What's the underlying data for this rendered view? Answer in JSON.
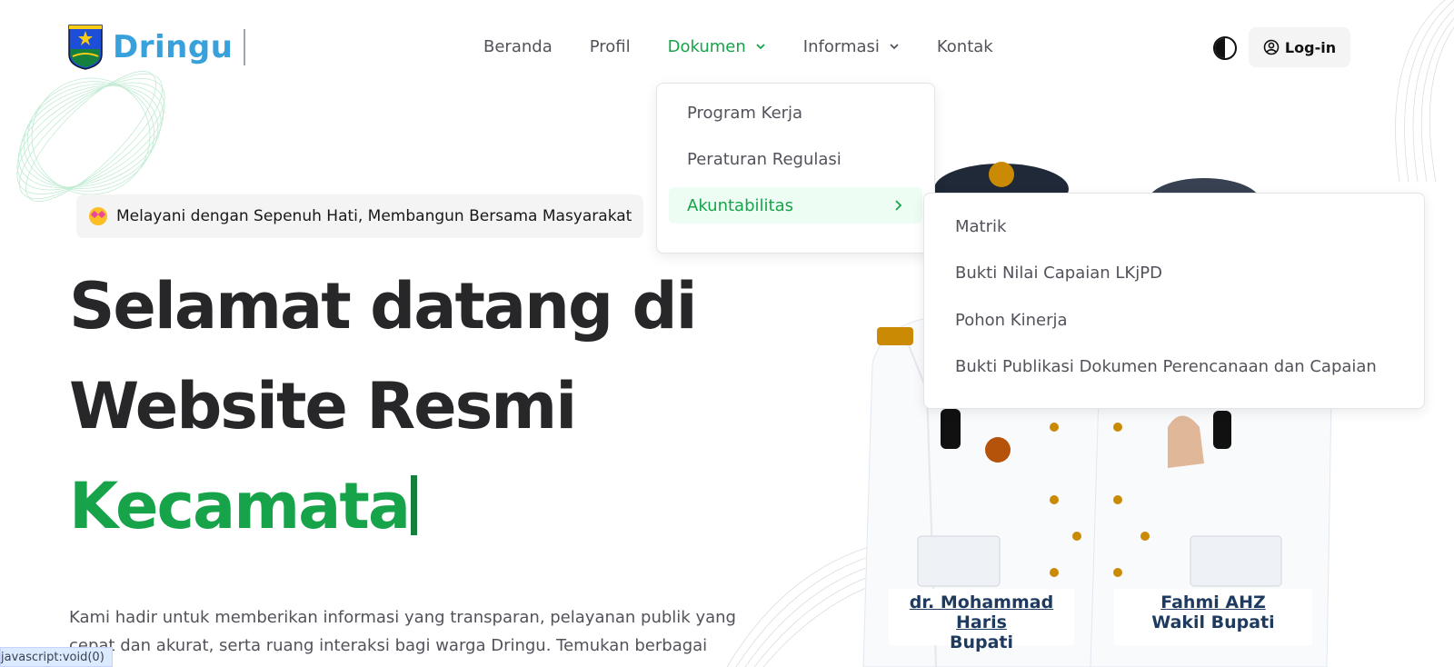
{
  "header": {
    "brand": "Dringu",
    "nav": [
      {
        "label": "Beranda"
      },
      {
        "label": "Profil"
      },
      {
        "label": "Dokumen"
      },
      {
        "label": "Informasi"
      },
      {
        "label": "Kontak"
      }
    ],
    "login_label": "Log-in"
  },
  "dropdown": {
    "items": [
      {
        "label": "Program Kerja"
      },
      {
        "label": "Peraturan Regulasi"
      },
      {
        "label": "Akuntabilitas"
      }
    ]
  },
  "submenu": {
    "items": [
      {
        "label": "Matrik"
      },
      {
        "label": "Bukti Nilai Capaian LKjPD"
      },
      {
        "label": "Pohon Kinerja"
      },
      {
        "label": "Bukti Publikasi Dokumen Perencanaan dan Capaian"
      }
    ]
  },
  "hero": {
    "tagline": "Melayani dengan Sepenuh Hati, Membangun Bersama Masyarakat",
    "line1": "Selamat datang di",
    "line2": "Website Resmi",
    "line3": "Kecamata",
    "description_line1": "Kami hadir untuk memberikan informasi yang transparan, pelayanan publik yang",
    "description_line2": "cepat dan akurat, serta ruang interaksi bagi warga Dringu. Temukan berbagai"
  },
  "officials": [
    {
      "name": "dr. Mohammad Haris",
      "title": "Bupati"
    },
    {
      "name": "Fahmi AHZ",
      "title": "Wakil Bupati"
    }
  ],
  "status_bar": {
    "url": "javascript:void(0)"
  },
  "colors": {
    "accent_green": "#16a34a",
    "brand_blue": "#38a1db",
    "heading": "#27272a",
    "body_text": "#52525b"
  },
  "icons": {
    "theme": "half-circle-contrast-icon",
    "login": "user-circle-icon",
    "submenu": "chevron-right-icon",
    "nav_dropdown": "chevron-down-icon"
  }
}
